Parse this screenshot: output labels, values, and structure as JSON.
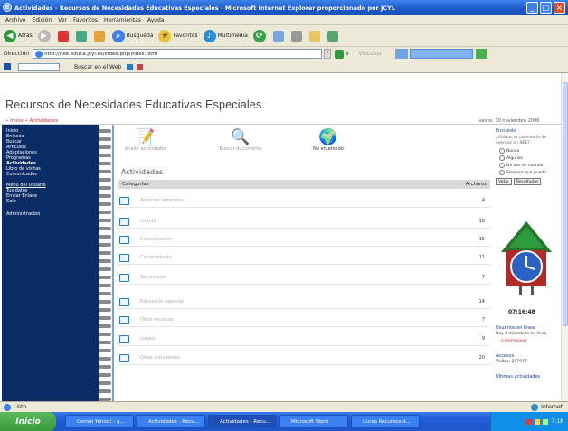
{
  "window": {
    "title": "Actividades - Recursos de Necesidades Educativas Especiales - Microsoft Internet Explorer proporcionado por JCYL",
    "controls": {
      "min": "_",
      "max": "□",
      "close": "×"
    }
  },
  "menu": [
    "Archivo",
    "Edición",
    "Ver",
    "Favoritos",
    "Herramientas",
    "Ayuda"
  ],
  "toolbar": {
    "back": "Atrás",
    "search": "Búsqueda",
    "favorites": "Favoritos",
    "multimedia": "Multimedia"
  },
  "address": {
    "label": "Dirección",
    "url": "http://nee.educa.jcyl.es/index.php/index.html",
    "go": "Ir",
    "links": "Vínculos"
  },
  "links": {
    "search_label": "Buscar en el Web"
  },
  "page": {
    "title": "Recursos de Necesidades Educativas Especiales.",
    "breadcrumb": "» Inicio » Actividades",
    "date": "jueves, 30 noviembre 2006"
  },
  "sidenav": {
    "items": [
      "Inicio",
      "Enlaces",
      "Buscar",
      "Artículos",
      "Adaptaciones",
      "Programas",
      "Actividades",
      "Libro de visitas",
      "Comunicados"
    ],
    "section_title": "Menú del Usuario",
    "user_items": [
      "Tus datos",
      "Enviar Enlace",
      "Salir"
    ],
    "admin": "Administración"
  },
  "main": {
    "icons": [
      {
        "label": "Añadir actividades",
        "glyph": "📝"
      },
      {
        "label": "Buscar documento",
        "glyph": "🔍"
      },
      {
        "label": "No entendido",
        "glyph": "🌍"
      }
    ],
    "section_title": "Actividades",
    "columns": {
      "category": "Categorías",
      "count": "Archivos"
    },
    "rows": [
      {
        "title": "Atención temprana",
        "count": "4"
      },
      {
        "title": "Infantil",
        "count": "16"
      },
      {
        "title": "Comunicación",
        "count": "15"
      },
      {
        "title": "Conocimiento",
        "count": "11"
      },
      {
        "title": "Secundaria",
        "count": "7"
      },
      {
        "title": "Educación especial",
        "count": "14"
      },
      {
        "title": "Otros recursos",
        "count": "7"
      },
      {
        "title": "Juegos",
        "count": "9"
      },
      {
        "title": "Otras actividades",
        "count": "20"
      }
    ]
  },
  "right": {
    "poll_title": "Encuesta",
    "poll_question": "¿Utilizas el calendario de eventos en NEE?",
    "options": [
      "Nunca",
      "Algunas",
      "De vez en cuando",
      "Siempre que puedo"
    ],
    "vote": "Votar",
    "results": "Resultados",
    "clock_time": "07:16:48",
    "users_title": "Usuarios en línea",
    "users_line": "Hay 3 miembros en línea",
    "user_name": "jcdominguez",
    "access_title": "Accesos",
    "visits": "Visitas: 207977",
    "last_title": "Últimas actividades"
  },
  "status": {
    "text": "Listo",
    "zone": "Internet"
  },
  "taskbar": {
    "start": "Inicio",
    "tasks": [
      "Correo Yahoo! - q...",
      "Actividades - Recu...",
      "Actividades - Recu...",
      "Microsoft Word",
      "Curso Recursos d..."
    ],
    "time": "7:16"
  }
}
